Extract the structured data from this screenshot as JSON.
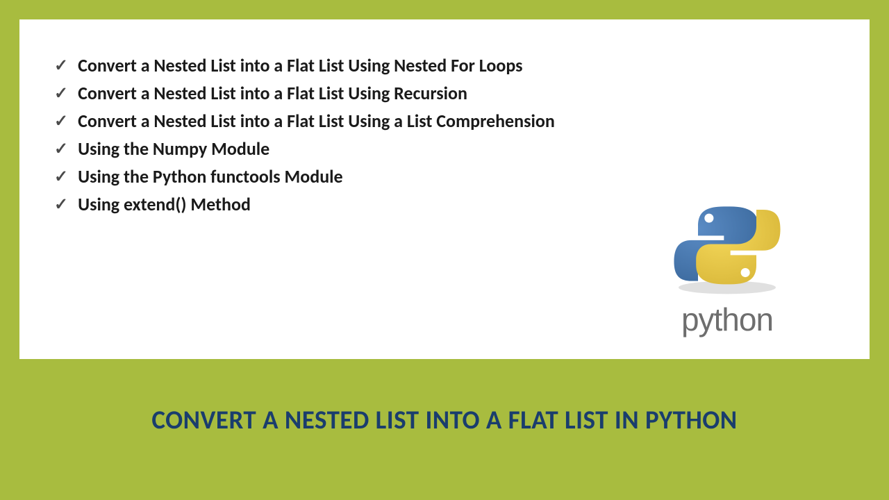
{
  "list": {
    "items": [
      "Convert a Nested List into a Flat List Using Nested For Loops",
      "Convert a Nested List into a Flat List Using Recursion",
      "Convert a Nested List into a Flat List Using a List Comprehension",
      "Using the Numpy Module",
      "Using the Python functools Module",
      "Using extend() Method"
    ]
  },
  "logo": {
    "text": "python"
  },
  "title": "CONVERT A NESTED LIST INTO A FLAT LIST IN PYTHON",
  "colors": {
    "background": "#a8bc3f",
    "titleText": "#1a3d6d",
    "listText": "#1a1a1a"
  }
}
